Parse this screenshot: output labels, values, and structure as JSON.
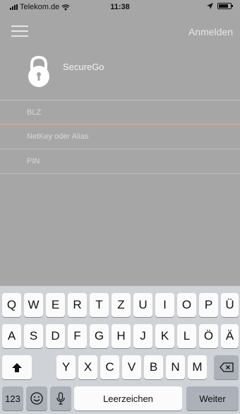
{
  "status_bar": {
    "carrier": "Telekom.de",
    "time": "11:38"
  },
  "navbar": {
    "menu_icon": "hamburger-menu-icon",
    "login_label": "Anmelden"
  },
  "header": {
    "app_icon": "padlock-icon",
    "app_name": "SecureGo"
  },
  "form": {
    "blz_placeholder": "BLZ",
    "netkey_placeholder": "NetKey oder Alias",
    "pin_placeholder": "PIN"
  },
  "colors": {
    "background": "#a6a6a6",
    "keyboard": "#cfd2d7",
    "field_focus_border": "#e0b088"
  },
  "keyboard": {
    "row1": [
      "Q",
      "W",
      "E",
      "R",
      "T",
      "Z",
      "U",
      "I",
      "O",
      "P",
      "Ü"
    ],
    "row2": [
      "A",
      "S",
      "D",
      "F",
      "G",
      "H",
      "J",
      "K",
      "L",
      "Ö",
      "Ä"
    ],
    "row3": [
      "Y",
      "X",
      "C",
      "V",
      "B",
      "N",
      "M"
    ],
    "numbers_key": "123",
    "space_key": "Leerzeichen",
    "return_key": "Weiter"
  }
}
